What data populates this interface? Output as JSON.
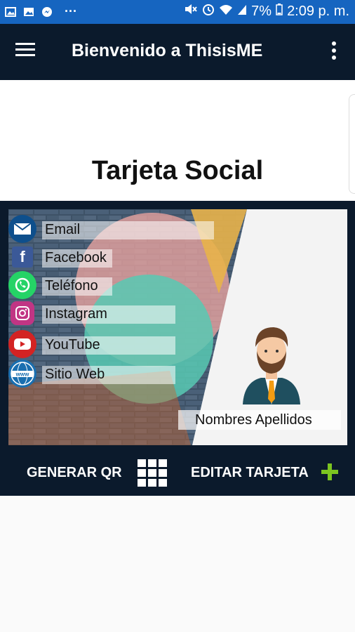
{
  "status_bar": {
    "battery": "7%",
    "time": "2:09 p. m.",
    "notification_more": "···",
    "icons": [
      "image-icon",
      "gallery-icon",
      "messenger-icon",
      "mute-icon",
      "alarm-icon",
      "wifi-icon",
      "signal-icon",
      "battery-icon"
    ]
  },
  "app_bar": {
    "title": "Bienvenido a ThisisME",
    "menu_icon": "hamburger-menu-icon",
    "more_icon": "more-vertical-icon"
  },
  "page": {
    "title": "Tarjeta Social"
  },
  "card": {
    "social_items": [
      {
        "label": "Email",
        "icon": "email-icon"
      },
      {
        "label": "Facebook",
        "icon": "facebook-icon"
      },
      {
        "label": "Teléfono",
        "icon": "whatsapp-icon"
      },
      {
        "label": "Instagram",
        "icon": "instagram-icon"
      },
      {
        "label": "YouTube",
        "icon": "youtube-icon"
      },
      {
        "label": "Sitio Web",
        "icon": "www-icon"
      }
    ],
    "name": "Nombres Apellidos",
    "avatar_icon": "man-avatar-icon"
  },
  "actions": {
    "generate_qr": "GENERAR QR",
    "edit_card": "EDITAR TARJETA",
    "qr_icon": "grid-icon",
    "add_icon": "plus-icon"
  },
  "colors": {
    "status_bar": "#1665c0",
    "app_bar": "#0b1a2c",
    "add_green": "#7cc520"
  }
}
